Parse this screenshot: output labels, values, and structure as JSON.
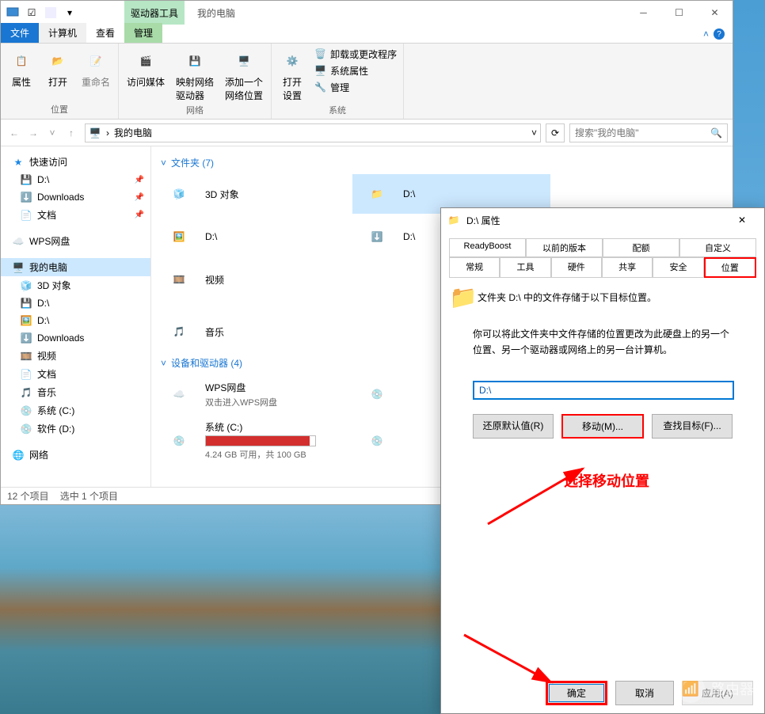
{
  "explorer": {
    "tools_tab_top": "驱动器工具",
    "tools_tab_bottom": "管理",
    "title": "我的电脑",
    "tabs": {
      "file": "文件",
      "computer": "计算机",
      "view": "查看"
    },
    "ribbon": {
      "g1": {
        "btns": [
          "属性",
          "打开",
          "重命名"
        ],
        "label": "位置"
      },
      "g2": {
        "btns": [
          "访问媒体",
          "映射网络\n驱动器",
          "添加一个\n网络位置"
        ],
        "label": "网络"
      },
      "g3": {
        "btn": "打开\n设置",
        "side": [
          "卸载或更改程序",
          "系统属性",
          "管理"
        ],
        "label": "系统"
      }
    },
    "address": "我的电脑",
    "search_placeholder": "搜索\"我的电脑\"",
    "sidebar": {
      "quick": "快速访问",
      "quick_items": [
        "D:\\",
        "Downloads",
        "文档"
      ],
      "wps": "WPS网盘",
      "thispc": "我的电脑",
      "pc_items": [
        "3D 对象",
        "D:\\",
        "D:\\",
        "Downloads",
        "视频",
        "文档",
        "音乐",
        "系统 (C:)",
        "软件 (D:)"
      ],
      "network": "网络"
    },
    "folders_head": "文件夹 (7)",
    "folders": [
      "3D 对象",
      "D:\\",
      "D:\\",
      "D:\\",
      "视频",
      "音乐"
    ],
    "devices_head": "设备和驱动器 (4)",
    "devices": {
      "wps": {
        "name": "WPS网盘",
        "sub": "双击进入WPS网盘"
      },
      "c": {
        "name": "系统 (C:)",
        "sub": "4.24 GB 可用，共 100 GB",
        "used_pct": 95
      }
    },
    "status": {
      "count": "12 个项目",
      "selected": "选中 1 个项目"
    }
  },
  "dialog": {
    "title": "D:\\ 属性",
    "tabs_row1": [
      "ReadyBoost",
      "以前的版本",
      "配额",
      "自定义"
    ],
    "tabs_row2": [
      "常规",
      "工具",
      "硬件",
      "共享",
      "安全",
      "位置"
    ],
    "line1": "文件夹 D:\\ 中的文件存储于以下目标位置。",
    "line2": "你可以将此文件夹中文件存储的位置更改为此硬盘上的另一个位置、另一个驱动器或网络上的另一台计算机。",
    "input_value": "D:\\",
    "btns": [
      "还原默认值(R)",
      "移动(M)...",
      "查找目标(F)..."
    ],
    "ok": "确定",
    "cancel": "取消",
    "apply": "应用(A)"
  },
  "annotation": "选择移动位置",
  "watermark": "路由器"
}
